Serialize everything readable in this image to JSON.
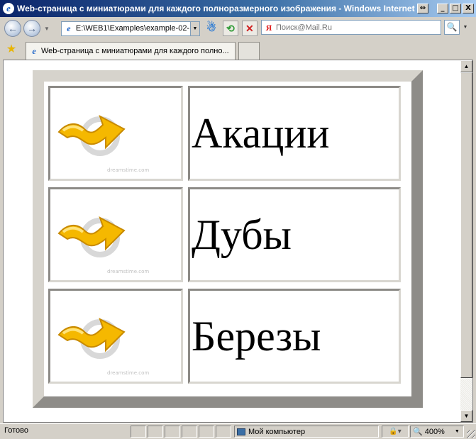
{
  "window": {
    "title": "Web-страница с миниатюрами для каждого полноразмерного изображения - Windows Internet Explorer",
    "buttons": {
      "minimize": "_",
      "maximize": "□",
      "close": "X",
      "restore": "⇔"
    }
  },
  "navbar": {
    "back_glyph": "←",
    "forward_glyph": "→",
    "address": "E:\\WEB1\\Examples\\example-02-",
    "search_placeholder": "Поиск@Mail.Ru"
  },
  "tabs": [
    {
      "label": "Web-страница с миниатюрами для каждого полно..."
    }
  ],
  "content": {
    "rows": [
      {
        "label": "Акации",
        "thumb_icon": "arrow-thumbnail",
        "watermark": "dreamstime.com"
      },
      {
        "label": "Дубы",
        "thumb_icon": "arrow-thumbnail",
        "watermark": "dreamstime.com"
      },
      {
        "label": "Березы",
        "thumb_icon": "arrow-thumbnail",
        "watermark": "dreamstime.com"
      }
    ],
    "arrow_colors": {
      "fill": "#f5b800",
      "highlight": "#ffe37a",
      "outline": "#c88a00",
      "shadow": "#c8c8c8"
    }
  },
  "statusbar": {
    "status": "Готово",
    "zone": "Мой компьютер",
    "zoom": "400%"
  },
  "colors": {
    "titlebar_start": "#0a246a",
    "chrome": "#d4d0c8",
    "link_blue": "#1e64c8"
  }
}
